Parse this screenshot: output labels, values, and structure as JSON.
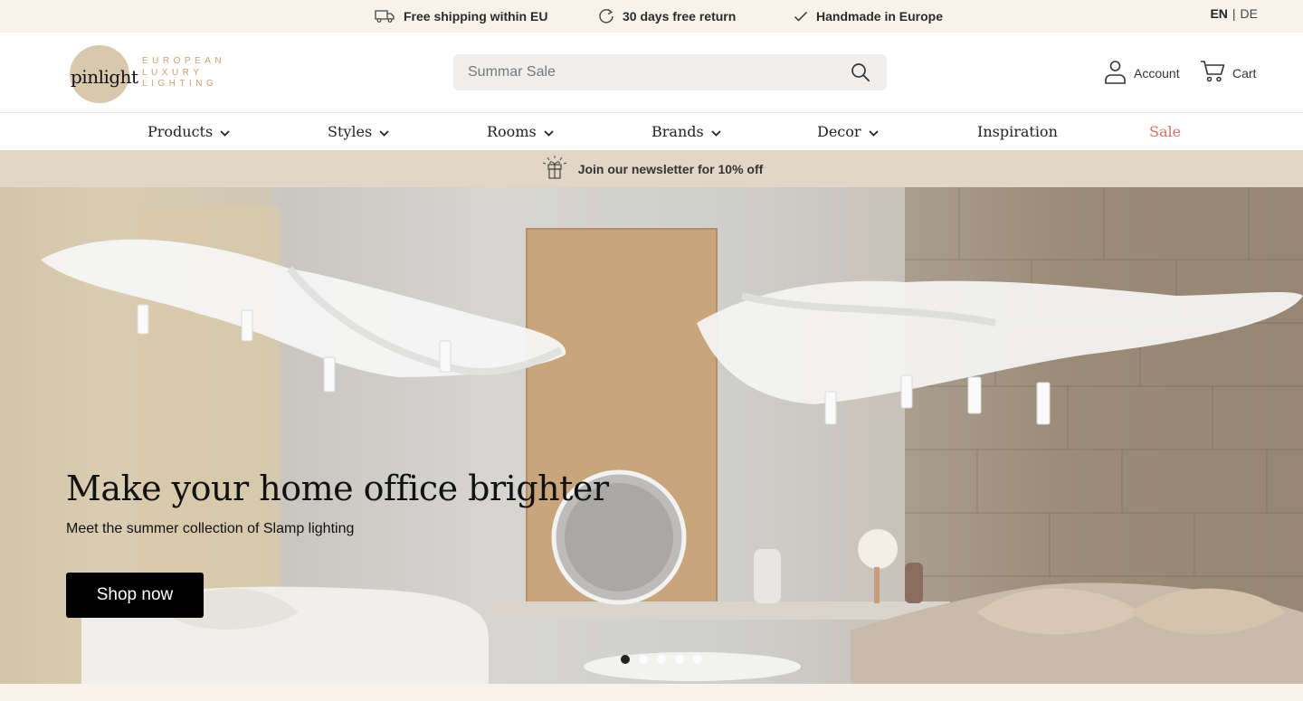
{
  "topbar": {
    "usps": [
      {
        "icon": "truck-icon",
        "label": "Free shipping within EU"
      },
      {
        "icon": "return-icon",
        "label": "30 days free return"
      },
      {
        "icon": "check-icon",
        "label": "Handmade in Europe"
      }
    ],
    "lang_active": "EN",
    "lang_separator": "|",
    "lang_other": "DE"
  },
  "header": {
    "logo_word": "pinlight",
    "logo_tag_1": "EUROPEAN",
    "logo_tag_2": "LUXURY",
    "logo_tag_3": "LIGHTING",
    "search_placeholder": "Summar Sale",
    "account_label": "Account",
    "cart_label": "Cart"
  },
  "nav": {
    "items": [
      {
        "label": "Products",
        "dropdown": true
      },
      {
        "label": "Styles",
        "dropdown": true
      },
      {
        "label": "Rooms",
        "dropdown": true
      },
      {
        "label": "Brands",
        "dropdown": true
      },
      {
        "label": "Decor",
        "dropdown": true
      },
      {
        "label": "Inspiration",
        "dropdown": false
      },
      {
        "label": "Sale",
        "dropdown": false
      }
    ]
  },
  "newsletter": {
    "icon": "gift-icon",
    "label": "Join our newsletter for 10% off"
  },
  "hero": {
    "title": "Make your home office brighter",
    "subtitle": "Meet the summer collection of Slamp lighting",
    "cta_label": "Shop now",
    "slide_count": 5,
    "active_slide": 1
  },
  "colors": {
    "accent_sale": "#d9735a",
    "logo_circle": "#d8c9ad",
    "logo_tag": "#d89c71",
    "newsletter_bg": "#e2d7c6",
    "topbar_bg": "#f7f3ea"
  }
}
